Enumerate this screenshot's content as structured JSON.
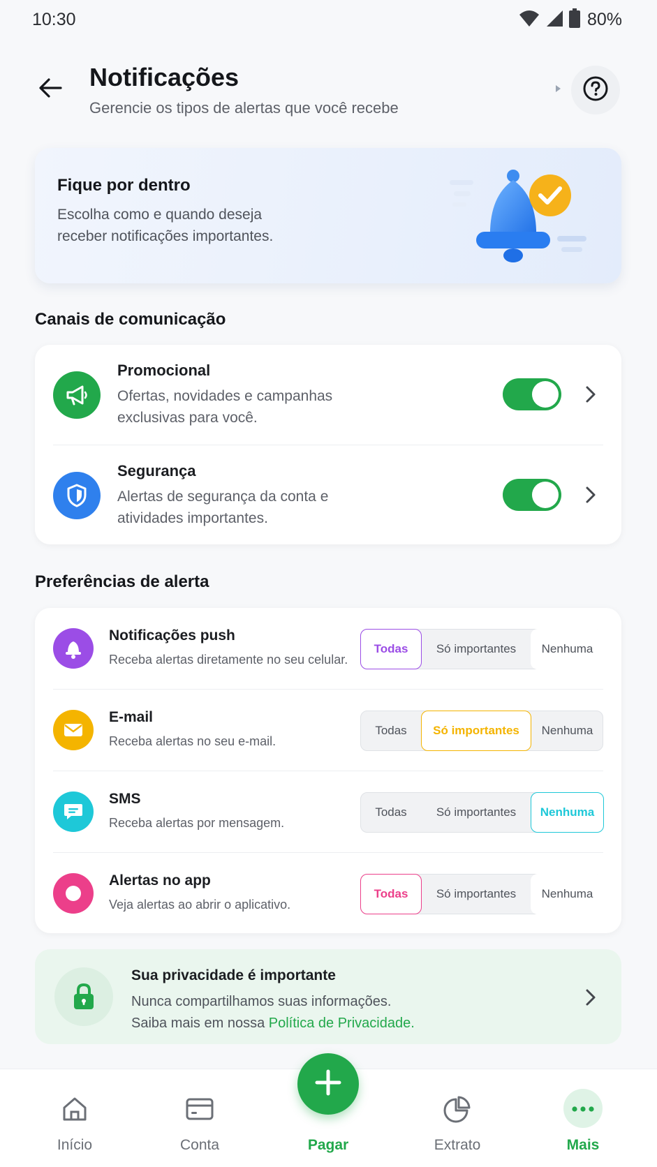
{
  "status_bar": {
    "time": "10:30",
    "battery": "80%"
  },
  "header": {
    "title": "Notificações",
    "subtitle": "Gerencie os tipos de alertas que você recebe"
  },
  "hero": {
    "title": "Fique por dentro",
    "text": "Escolha como e quando deseja receber notificações importantes."
  },
  "channels": {
    "section_title": "Canais de comunicação",
    "items": [
      {
        "title": "Promocional",
        "desc": "Ofertas, novidades e campanhas exclusivas para você.",
        "enabled": true,
        "icon": "megaphone-icon",
        "color": "#22a84b"
      },
      {
        "title": "Segurança",
        "desc": "Alertas de segurança da conta e atividades importantes.",
        "enabled": true,
        "icon": "shield-icon",
        "color": "#2f80ed"
      }
    ]
  },
  "preferences": {
    "section_title": "Preferências de alerta",
    "options": [
      "Todas",
      "Só importantes",
      "Nenhuma"
    ],
    "items": [
      {
        "title": "Notificações push",
        "desc": "Receba alertas diretamente no seu celular.",
        "selected": "Todas",
        "icon": "bell-icon",
        "color": "#9b4de6"
      },
      {
        "title": "E-mail",
        "desc": "Receba alertas no seu e-mail.",
        "selected": "Só importantes",
        "icon": "envelope-icon",
        "color": "#f4b400"
      },
      {
        "title": "SMS",
        "desc": "Receba alertas por mensagem.",
        "selected": "Nenhuma",
        "icon": "chat-bubble-icon",
        "color": "#1ec8d8"
      },
      {
        "title": "Alertas no app",
        "desc": "Veja alertas ao abrir o aplicativo.",
        "selected": "Todas",
        "icon": "ring-icon",
        "color": "#ec3f8a"
      }
    ]
  },
  "privacy": {
    "title": "Sua privacidade é importante",
    "line1": "Nunca compartilhamos suas informações.",
    "line2_prefix": "Saiba mais em nossa ",
    "link": "Política de Privacidade."
  },
  "bottom_nav": {
    "items": [
      {
        "label": "Início",
        "icon": "home-icon"
      },
      {
        "label": "Conta",
        "icon": "card-icon"
      },
      {
        "label": "Pagar",
        "icon": "plus-icon",
        "active": true
      },
      {
        "label": "Extrato",
        "icon": "pie-chart-icon"
      },
      {
        "label": "Mais",
        "icon": "more-dots-icon",
        "active": true
      }
    ]
  },
  "colors": {
    "accent": "#22a84b"
  }
}
